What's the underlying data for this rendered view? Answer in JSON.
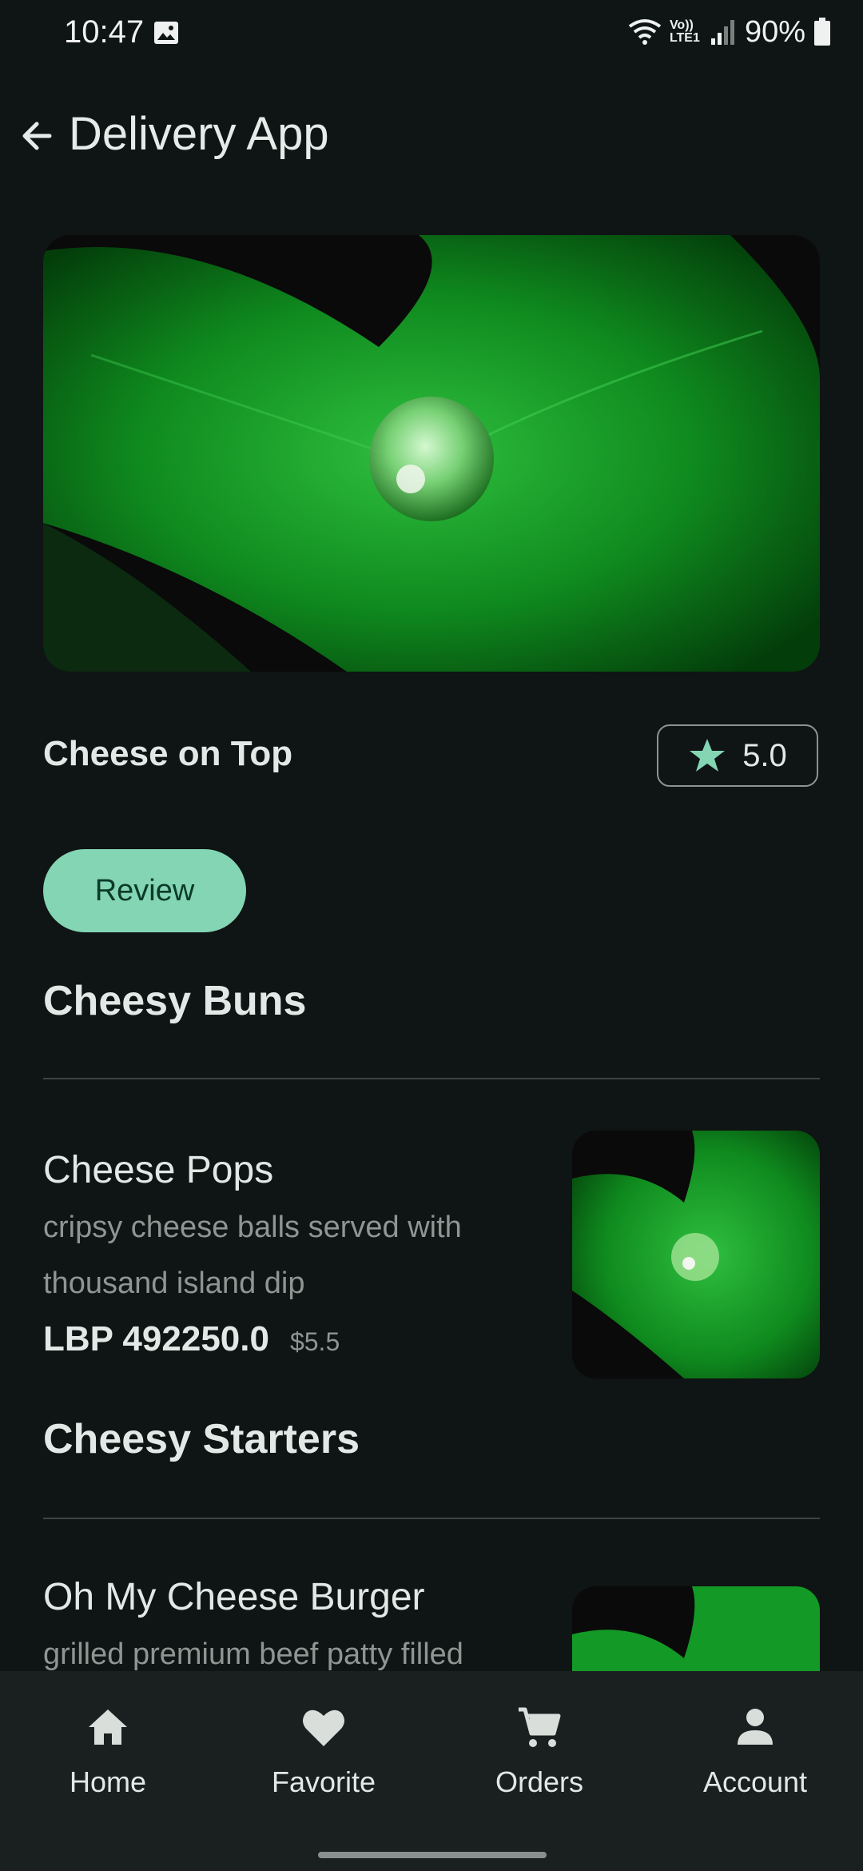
{
  "status_bar": {
    "time": "10:47",
    "network_label": "Vo)) LTE1",
    "battery": "90%"
  },
  "app_bar": {
    "title": "Delivery App",
    "back_icon": "arrow-left-icon"
  },
  "restaurant": {
    "name": "Cheese on Top",
    "rating": "5.0",
    "rating_icon": "star-icon",
    "review_button": "Review"
  },
  "sections": [
    {
      "title": "Cheesy Buns",
      "items": [
        {
          "name": "Cheese Pops",
          "description": "cripsy cheese balls served with thousand island dip",
          "price_lbp": "LBP 492250.0",
          "price_usd": "$5.5"
        }
      ]
    },
    {
      "title": "Cheesy Starters",
      "items": [
        {
          "name": "Oh My Cheese Burger",
          "description": "grilled premium beef patty filled"
        }
      ]
    }
  ],
  "bottom_nav": [
    {
      "label": "Home",
      "icon": "home-icon"
    },
    {
      "label": "Favorite",
      "icon": "heart-icon"
    },
    {
      "label": "Orders",
      "icon": "cart-icon"
    },
    {
      "label": "Account",
      "icon": "person-icon"
    }
  ],
  "colors": {
    "background": "#0f1414",
    "accent": "#83d5b3",
    "nav_background": "#1a2020"
  }
}
